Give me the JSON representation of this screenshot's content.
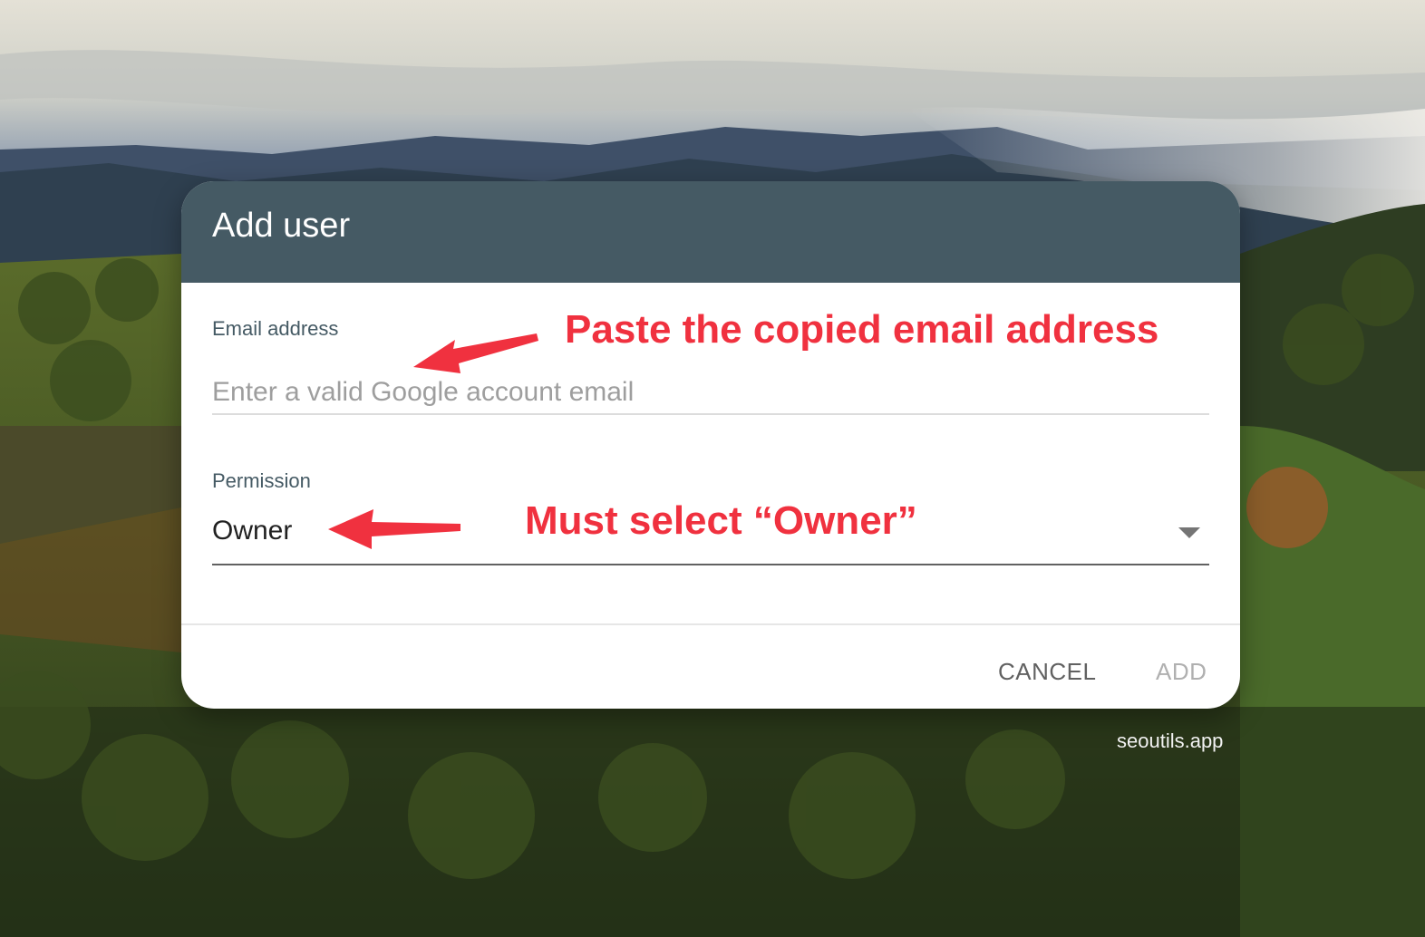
{
  "dialog": {
    "title": "Add user",
    "email": {
      "label": "Email address",
      "placeholder": "Enter a valid Google account email",
      "value": ""
    },
    "permission": {
      "label": "Permission",
      "selected": "Owner"
    },
    "actions": {
      "cancel_label": "CANCEL",
      "add_label": "ADD"
    }
  },
  "annotations": {
    "email_hint": "Paste the copied email address",
    "permission_hint": "Must select “Owner”",
    "color": "#f0313f"
  },
  "watermark": "seoutils.app",
  "colors": {
    "header": "#455a64",
    "annotation": "#f0313f"
  },
  "icons": {
    "dropdown": "triangle-down-icon",
    "arrow": "left-arrow-icon"
  }
}
